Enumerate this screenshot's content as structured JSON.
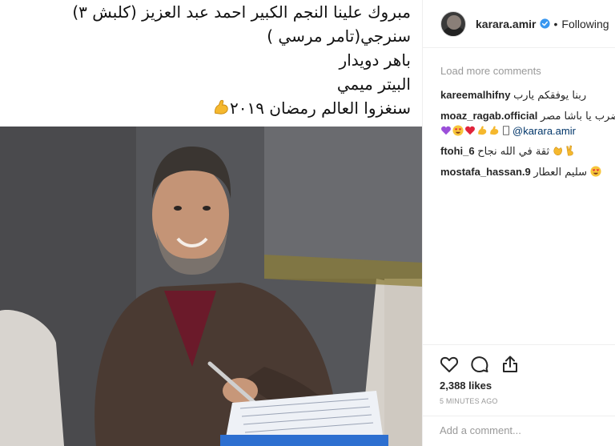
{
  "post": {
    "caption_lines": [
      "مبروك علينا النجم الكبير احمد عبد العزيز  (كلبش ٣)",
      "سنرجي(تامر مرسي )",
      "باهر دويدار",
      "البيتر ميمي",
      "سنغزوا العالم رمضان ٢٠١٩"
    ],
    "caption_emoji": "flexed-biceps"
  },
  "header": {
    "username": "karara.amir",
    "verified": true,
    "separator": "•",
    "follow_status": "Following"
  },
  "comments_section": {
    "load_more": "Load more comments",
    "comments": [
      {
        "user": "kareemalhifny",
        "text": "ربنا يوفقكم يارب"
      },
      {
        "user": "moaz_ragab.official",
        "text": "اضرب يا باشا مصر",
        "emoji_line": [
          "purple-heart",
          "heart-eyes",
          "red-heart",
          "flexed-biceps",
          "flexed-biceps",
          "box"
        ],
        "mention": "@karara.amir"
      },
      {
        "user": "ftohi_6",
        "text": "ثقة في الله نجاح",
        "emoji": [
          "clapping",
          "victory-hand"
        ]
      },
      {
        "user": "mostafa_hassan.9",
        "text": "سليم العطار",
        "emoji": [
          "heart-eyes"
        ]
      }
    ]
  },
  "actions": {
    "icons": [
      "heart-icon",
      "comment-icon",
      "share-icon"
    ],
    "likes": "2,388 likes",
    "timestamp": "5 MINUTES AGO",
    "add_comment_placeholder": "Add a comment..."
  },
  "colors": {
    "verified": "#3897f0",
    "muted": "#999999",
    "mention": "#003569",
    "border": "#efefef"
  }
}
